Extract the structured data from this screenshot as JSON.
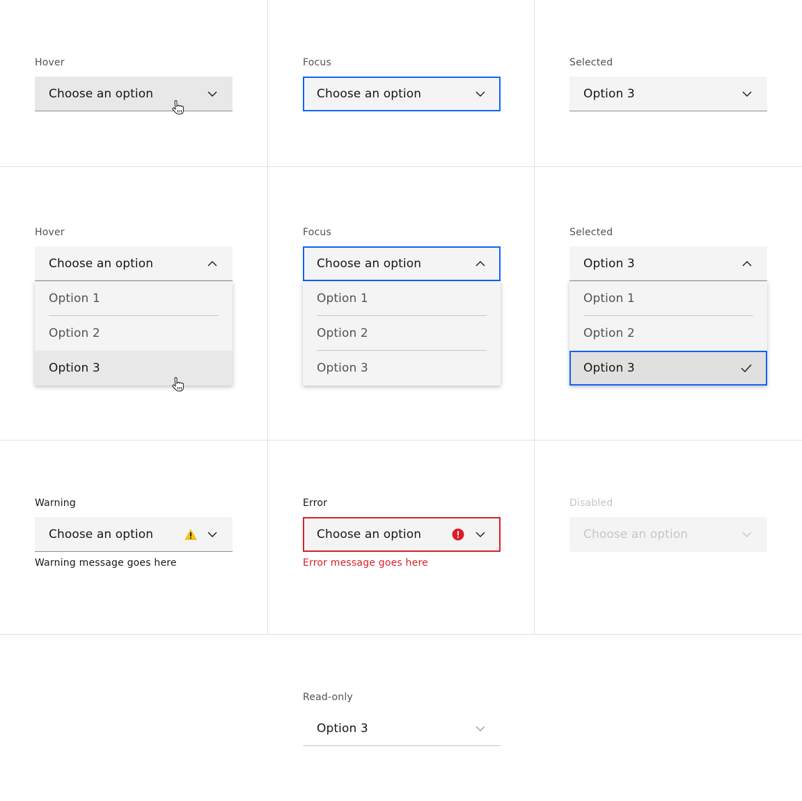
{
  "colors": {
    "focus": "#0f62fe",
    "error": "#da1e28",
    "warning": "#f1c21b",
    "field_bg": "#f4f4f4",
    "hover_bg": "#e8e8e8",
    "disabled_text": "#c6c6c6"
  },
  "row1": {
    "hover": {
      "label": "Hover",
      "value": "Choose an option",
      "icon": "chevron-down-icon"
    },
    "focus": {
      "label": "Focus",
      "value": "Choose an option",
      "icon": "chevron-down-icon"
    },
    "selected": {
      "label": "Selected",
      "value": "Option 3",
      "icon": "chevron-down-icon"
    }
  },
  "row2": {
    "hover": {
      "label": "Hover",
      "value": "Choose an option",
      "icon": "chevron-up-icon",
      "options": [
        "Option 1",
        "Option 2",
        "Option 3"
      ],
      "hovered_option": "Option 3"
    },
    "focus": {
      "label": "Focus",
      "value": "Choose an option",
      "icon": "chevron-up-icon",
      "options": [
        "Option 1",
        "Option 2",
        "Option 3"
      ]
    },
    "selected": {
      "label": "Selected",
      "value": "Option 3",
      "icon": "chevron-up-icon",
      "options": [
        "Option 1",
        "Option 2",
        "Option 3"
      ],
      "selected_option": "Option 3"
    }
  },
  "row3": {
    "warning": {
      "label": "Warning",
      "value": "Choose an option",
      "helper": "Warning message goes here",
      "icon": "warning-icon"
    },
    "error": {
      "label": "Error",
      "value": "Choose an option",
      "helper": "Error message goes here",
      "icon": "error-icon"
    },
    "disabled": {
      "label": "Disabled",
      "value": "Choose an option"
    }
  },
  "row4": {
    "readonly": {
      "label": "Read-only",
      "value": "Option 3"
    }
  }
}
